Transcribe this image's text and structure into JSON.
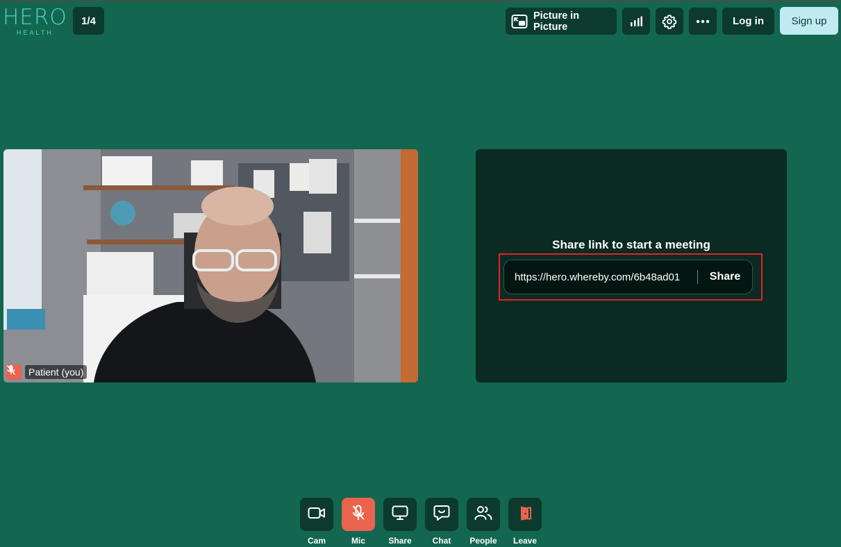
{
  "brand": {
    "name": "HERO",
    "sub": "HEALTH"
  },
  "participant_count": "1/4",
  "topbar": {
    "pip_label": "Picture in Picture",
    "login_label": "Log in",
    "signup_label": "Sign up"
  },
  "video": {
    "name": "Patient (you)"
  },
  "share": {
    "title": "Share link to start a meeting",
    "link": "https://hero.whereby.com/6b48ad01",
    "button": "Share"
  },
  "controls": [
    {
      "label": "Cam",
      "icon": "camera-icon"
    },
    {
      "label": "Mic",
      "icon": "mic-off-icon",
      "state": "muted"
    },
    {
      "label": "Share",
      "icon": "screen-share-icon"
    },
    {
      "label": "Chat",
      "icon": "chat-icon"
    },
    {
      "label": "People",
      "icon": "people-icon"
    },
    {
      "label": "Leave",
      "icon": "leave-icon"
    }
  ],
  "colors": {
    "background": "#136650",
    "panel": "#0c3a2f",
    "muted": "#e9634e",
    "signup": "#c1ebf2",
    "highlight": "#e1242b"
  }
}
